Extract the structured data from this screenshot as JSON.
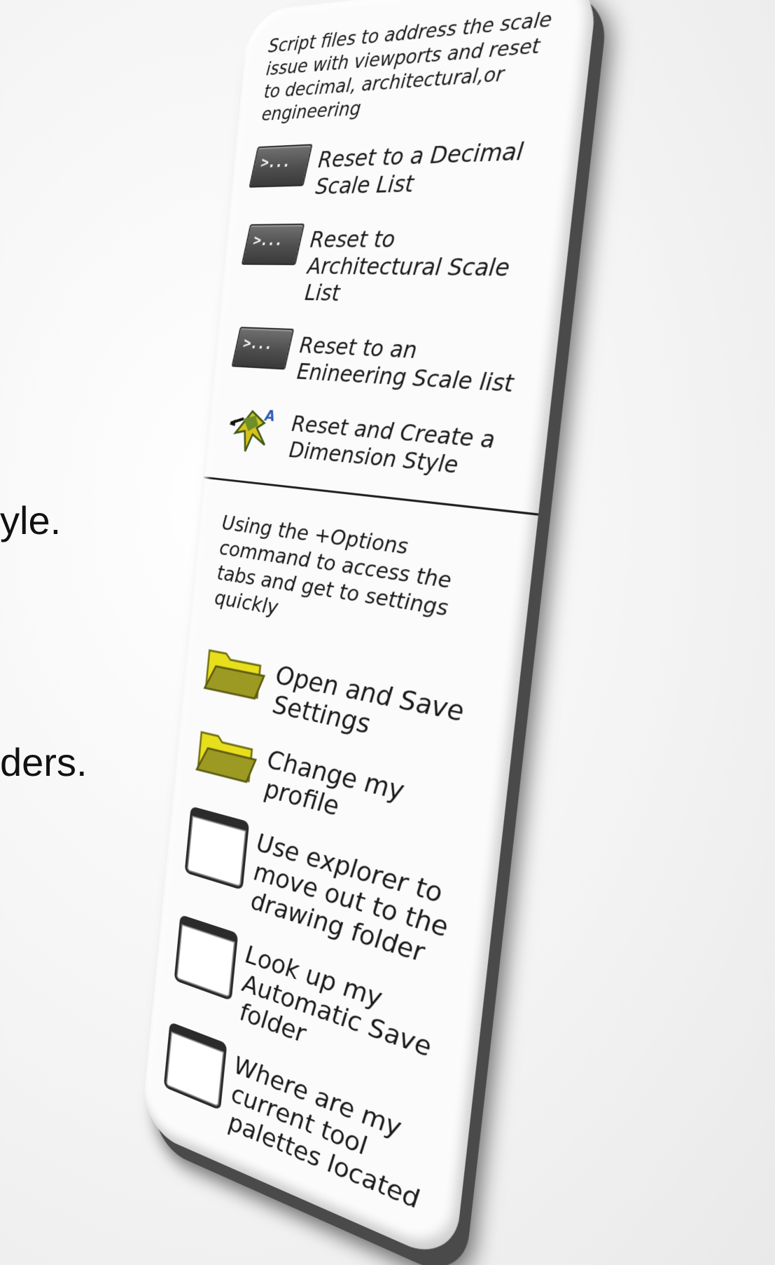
{
  "slide_fragments": {
    "line1": "yle.",
    "line2": "ders."
  },
  "palette": {
    "section1": {
      "description": "Script files to address the scale issue with viewports and reset to decimal, architectural,or engineering",
      "items": [
        {
          "label": "Reset to a Decimal Scale List",
          "icon": "script-icon"
        },
        {
          "label": "Reset to Architectural Scale List",
          "icon": "script-icon"
        },
        {
          "label": "Reset to an Enineering Scale list",
          "icon": "script-icon"
        },
        {
          "label": "Reset and Create a Dimension Style",
          "icon": "dimension-style-icon"
        }
      ],
      "script_glyph": ">..."
    },
    "section2": {
      "description": "Using the +Options command to access the tabs and get to settings quickly",
      "items": [
        {
          "label": "Open and Save Settings",
          "icon": "folder-icon"
        },
        {
          "label": "Change my profile",
          "icon": "folder-icon"
        },
        {
          "label": "Use explorer to move out to the drawing folder",
          "icon": "window-icon"
        },
        {
          "label": "Look up my Automatic Save folder",
          "icon": "window-icon"
        },
        {
          "label": "Where are my current tool palettes located",
          "icon": "window-icon"
        }
      ]
    },
    "colors": {
      "folder": "#f2ea2a",
      "folder_dark": "#8a8a1e",
      "script_icon": "#555555"
    }
  }
}
